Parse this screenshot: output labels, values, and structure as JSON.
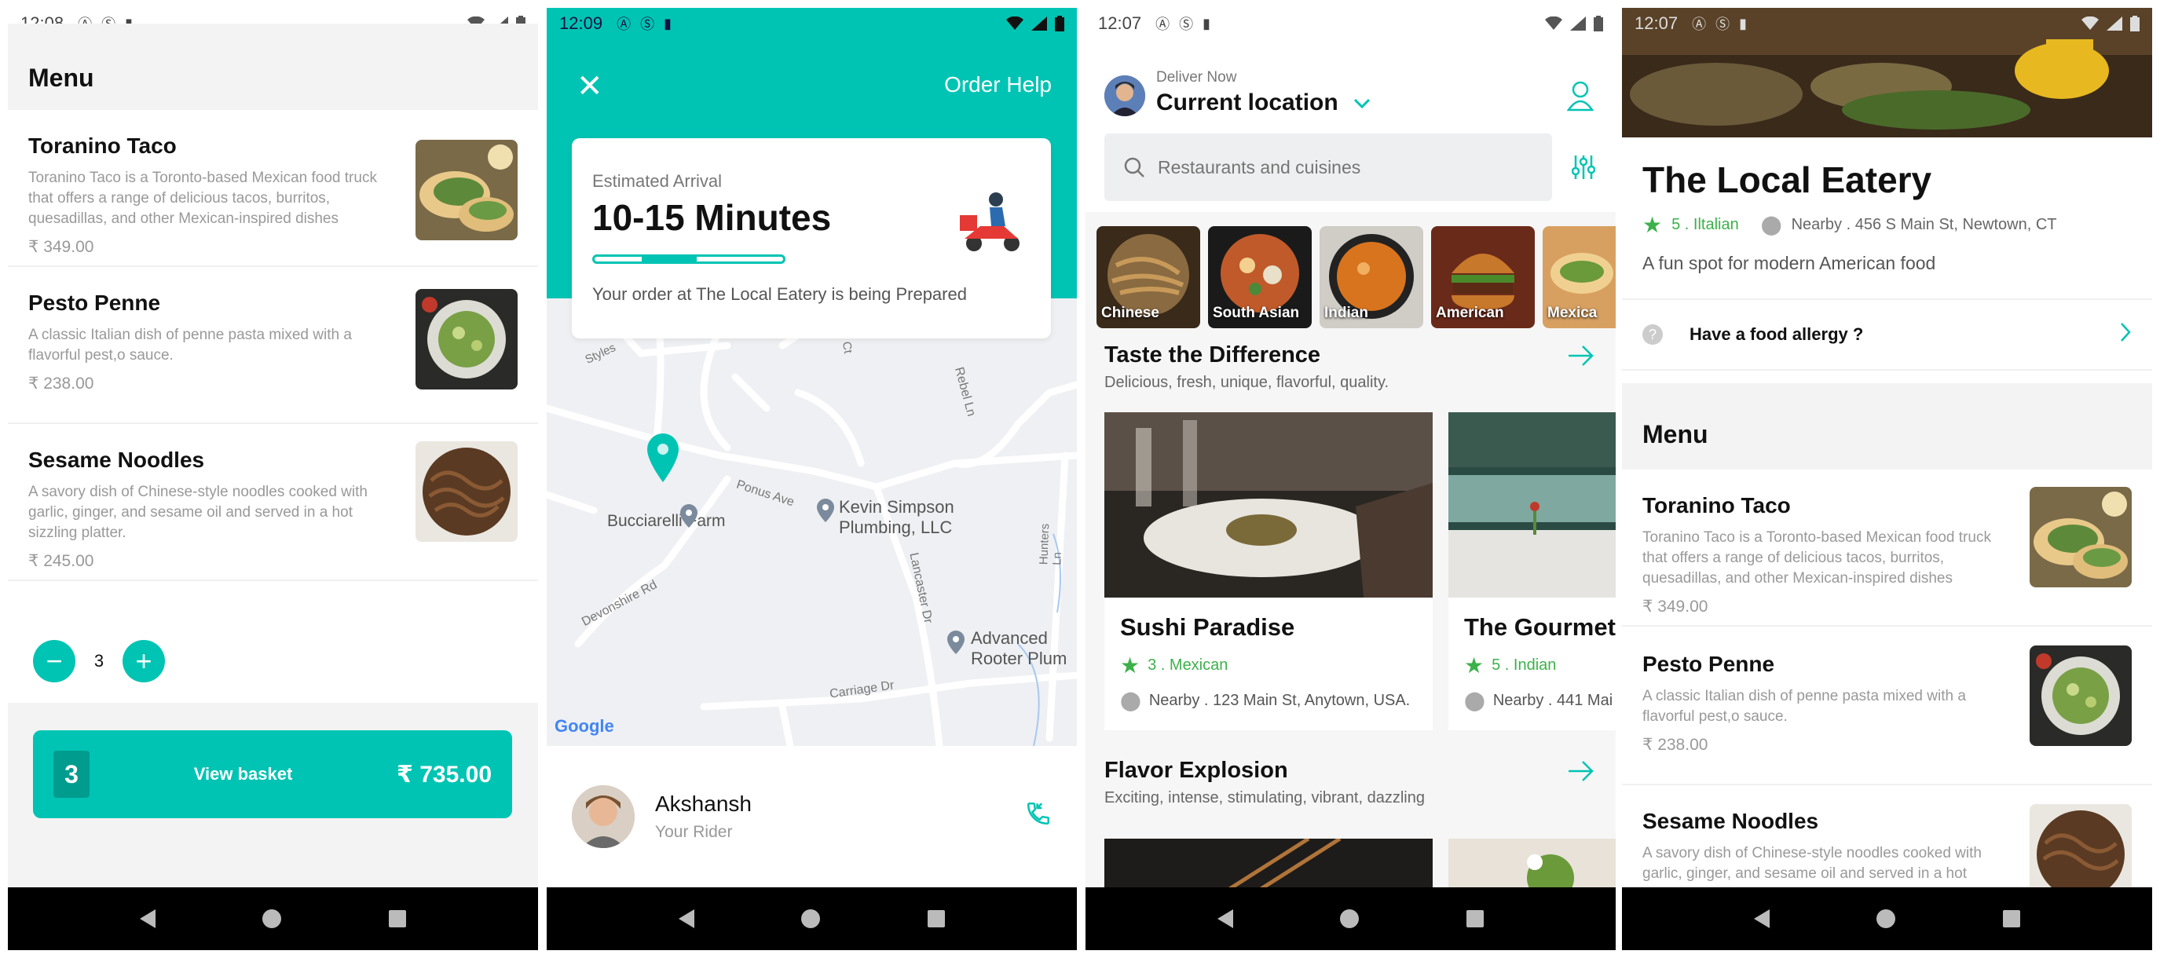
{
  "screens": {
    "menu": {
      "status_time": "12:08",
      "header_title": "Menu",
      "items": [
        {
          "name": "Toranino Taco",
          "description": "Toranino Taco is a Toronto-based Mexican food truck that offers a range of delicious tacos, burritos, quesadillas, and other Mexican-inspired dishes",
          "price": "₹ 349.00"
        },
        {
          "name": " Pesto Penne",
          "description": "A classic Italian dish of penne pasta mixed with a flavorful pest,o sauce.",
          "price": "₹ 238.00"
        },
        {
          "name": "Sesame Noodles",
          "description": "A savory dish of Chinese-style noodles cooked with garlic, ginger, and sesame oil and served in a hot sizzling platter.",
          "price": "₹ 245.00"
        }
      ],
      "stepper": {
        "minus": "−",
        "value": "3",
        "plus": "+"
      },
      "basket": {
        "count": "3",
        "label": "View basket",
        "total": "₹ 735.00"
      }
    },
    "tracking": {
      "status_time": "12:09",
      "order_help": "Order Help",
      "eta_label": "Estimated Arrival",
      "eta_value": "10-15 Minutes",
      "eta_progress": 0.45,
      "eta_message": "Your order at The Local Eatery is being Prepared",
      "map_labels": {
        "styles": "Styles",
        "ct": "Ct",
        "rebel": "Rebel Ln",
        "ponus": "Ponus Ave",
        "bucciarelli": "Bucciarelli Farm",
        "kevin1": "Kevin Simpson",
        "kevin2": "Plumbing, LLC",
        "devonshire": "Devonshire Rd",
        "lancaster": "Lancaster Dr",
        "hunters": "Hunters Ln",
        "advanced1": "Advanced",
        "advanced2": "Rooter Plum",
        "carriage": "Carriage Dr",
        "google": "Google"
      },
      "rider_name": "Akshansh",
      "rider_role": "Your Rider"
    },
    "home": {
      "status_time": "12:07",
      "deliver_now": "Deliver Now",
      "current_location": "Current location",
      "search_placeholder": "Restaurants and cuisines",
      "categories": [
        "Chinese",
        "South Asian",
        "Indian",
        "American",
        "Mexica"
      ],
      "section1": {
        "title": "Taste the Difference",
        "subtitle": "Delicious, fresh, unique, flavorful, quality."
      },
      "restaurants": [
        {
          "name": "Sushi Paradise",
          "rating": "3",
          "cuisine": "Mexican",
          "rating_text": "3 . Mexican",
          "address": "Nearby . 123 Main St, Anytown, USA."
        },
        {
          "name": "The Gourmet",
          "rating": "5",
          "cuisine": "Indian",
          "rating_text": "5 . Indian",
          "address": "Nearby . 441 Mai"
        }
      ],
      "section2": {
        "title": "Flavor Explosion",
        "subtitle": "Exciting, intense, stimulating, vibrant, dazzling"
      }
    },
    "restaurant": {
      "status_time": "12:07",
      "name": "The Local Eatery",
      "rating": "5",
      "cuisine": "Iltalian",
      "rating_text": "5 . Iltalian",
      "address": "Nearby .  456 S Main St, Newtown, CT",
      "description": "A fun spot for modern American food",
      "allergy_prompt": "Have a food allergy ?",
      "menu_title": "Menu",
      "items": [
        {
          "name": "Toranino Taco",
          "description": "Toranino Taco is a Toronto-based Mexican food truck that offers a range of delicious tacos, burritos, quesadillas, and other Mexican-inspired dishes",
          "price": "₹ 349.00"
        },
        {
          "name": " Pesto Penne",
          "description": "A classic Italian dish of penne pasta mixed with a flavorful pest,o sauce.",
          "price": "₹ 238.00"
        },
        {
          "name": "Sesame Noodles",
          "description": "A savory dish of Chinese-style noodles cooked with garlic, ginger, and sesame oil and served in a hot"
        }
      ]
    }
  },
  "colors": {
    "accent": "#00c4b3",
    "star": "#3cb14a",
    "basket_dark": "#009c8e"
  },
  "icons": [
    "close-icon",
    "scooter-icon",
    "phone-icon",
    "user-icon",
    "search-icon",
    "filter-icon",
    "arrow-right-icon",
    "star-icon",
    "pin-icon",
    "chevron-down-icon",
    "chevron-right-icon",
    "question-icon",
    "back-icon",
    "home-icon",
    "recents-icon",
    "wifi-icon",
    "signal-icon",
    "battery-icon"
  ]
}
